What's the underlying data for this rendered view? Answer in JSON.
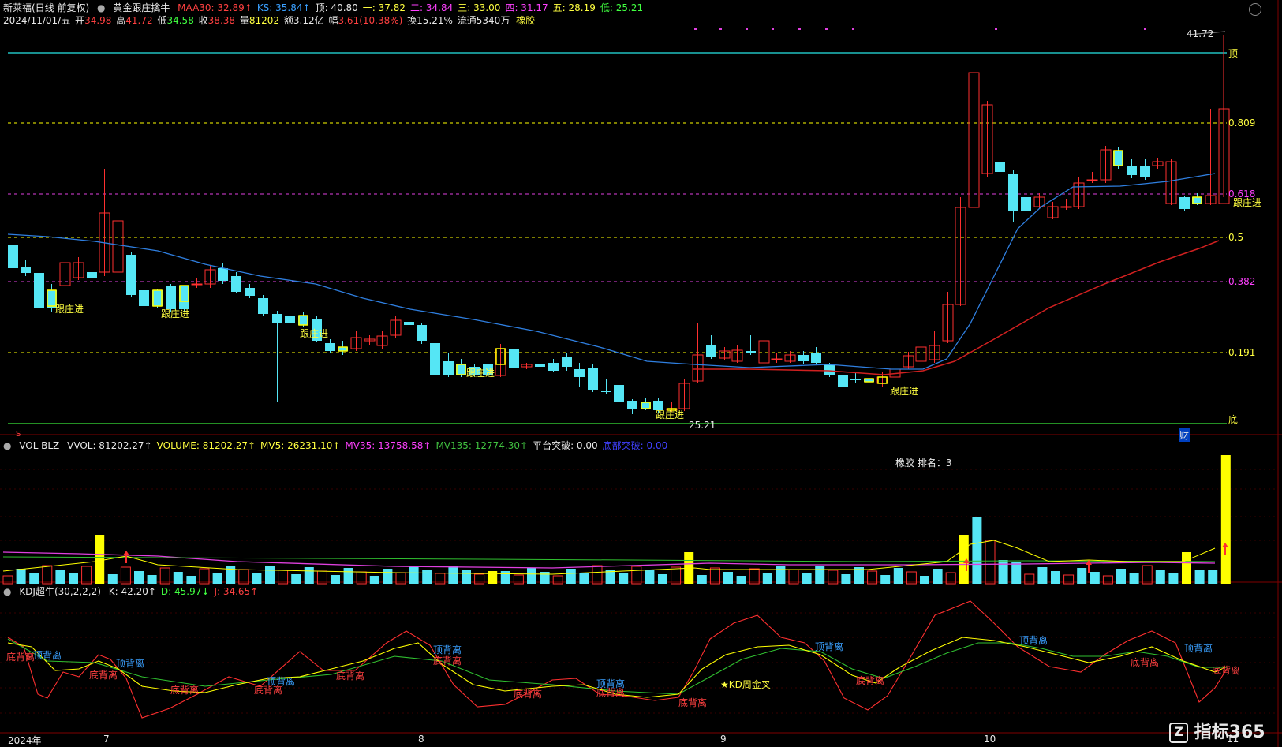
{
  "header": {
    "stock_name": "新莱福(日线 前复权)",
    "indicator_name": "黄金跟庄擒牛",
    "items": [
      {
        "label": "MAA30:",
        "value": "32.89",
        "arrow": "↑",
        "color": "#ff4040"
      },
      {
        "label": "KS:",
        "value": "35.84",
        "arrow": "↑",
        "color": "#3aa0ff"
      },
      {
        "label": "顶:",
        "value": "40.80",
        "arrow": "",
        "color": "#e8e8e8"
      },
      {
        "label": "一:",
        "value": "37.82",
        "arrow": "",
        "color": "#ffff40"
      },
      {
        "label": "二:",
        "value": "34.84",
        "arrow": "",
        "color": "#ff40ff"
      },
      {
        "label": "三:",
        "value": "33.00",
        "arrow": "",
        "color": "#ffff40"
      },
      {
        "label": "四:",
        "value": "31.17",
        "arrow": "",
        "color": "#ff40ff"
      },
      {
        "label": "五:",
        "value": "28.19",
        "arrow": "",
        "color": "#ffff40"
      },
      {
        "label": "低:",
        "value": "25.21",
        "arrow": "",
        "color": "#40ff40"
      }
    ]
  },
  "quote": {
    "date": "2024/11/01/五",
    "open_label": "开",
    "open": "34.98",
    "high_label": "高",
    "high": "41.72",
    "low_label": "低",
    "low": "34.58",
    "close_label": "收",
    "close": "38.38",
    "vol_label": "量",
    "vol": "81202",
    "amount_label": "额",
    "amount": "3.12亿",
    "change_label": "幅",
    "change": "3.61(10.38%)",
    "turnover_label": "换",
    "turnover": "15.21%",
    "float_label": "流通",
    "float": "5340万",
    "sector": "橡胶"
  },
  "price_levels": {
    "top": "41.72",
    "low": "25.21",
    "label_top": "顶",
    "label_bottom": "底",
    "fibs": [
      "0.809",
      "0.618",
      "0.5",
      "0.382",
      "0.191"
    ]
  },
  "signals": {
    "follow_label": "跟庄进",
    "marker_s": "S",
    "marker_cai": "财"
  },
  "volume_panel": {
    "title": "VOL-BLZ",
    "items": [
      {
        "label": "VVOL:",
        "value": "81202.27",
        "arrow": "↑",
        "color": "#e8e8e8"
      },
      {
        "label": "VOLUME:",
        "value": "81202.27",
        "arrow": "↑",
        "color": "#ffff40"
      },
      {
        "label": "MV5:",
        "value": "26231.10",
        "arrow": "↑",
        "color": "#ffff40"
      },
      {
        "label": "MV35:",
        "value": "13758.58",
        "arrow": "↑",
        "color": "#ff40ff"
      },
      {
        "label": "MV135:",
        "value": "12774.30",
        "arrow": "↑",
        "color": "#40c040"
      },
      {
        "label": "平台突破:",
        "value": "0.00",
        "arrow": "",
        "color": "#e8e8e8"
      },
      {
        "label": "底部突破:",
        "value": "0.00",
        "arrow": "",
        "color": "#4040ff"
      }
    ],
    "sector_rank": "橡胶    排名：3"
  },
  "kdj_panel": {
    "title": "KDJ超牛(30,2,2,2)",
    "items": [
      {
        "label": "K:",
        "value": "42.20",
        "arrow": "↑",
        "color": "#e8e8e8"
      },
      {
        "label": "D:",
        "value": "45.97",
        "arrow": "↓",
        "color": "#40ff40"
      },
      {
        "label": "J:",
        "value": "34.65",
        "arrow": "↑",
        "color": "#ff4040"
      }
    ],
    "top_div": "顶背离",
    "bottom_div": "底背离",
    "weekly_cross": "KD周金叉"
  },
  "time_axis": [
    "2024年",
    "7",
    "8",
    "9",
    "10",
    "11"
  ],
  "watermark": "指标365",
  "colors": {
    "up": "#ff3030",
    "down": "#55e6f5",
    "ma_blue": "#2f7fe0",
    "ma_red": "#d02020",
    "cyan_line": "#20c0c0",
    "yellow": "#ffff00",
    "magenta": "#e040e0",
    "green": "#30c030"
  }
}
